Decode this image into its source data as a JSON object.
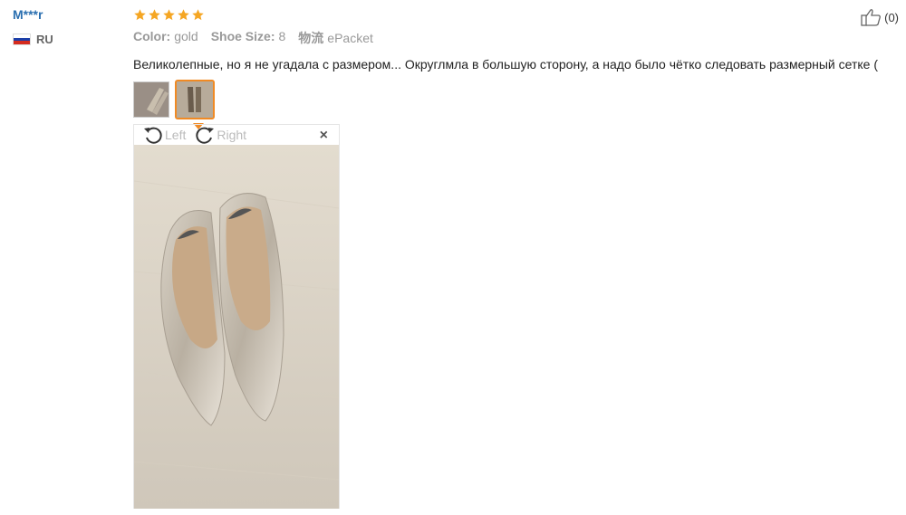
{
  "user": {
    "name": "M***r",
    "country_code": "RU",
    "flag_colors": [
      "#ffffff",
      "#1c3fa8",
      "#d52b1e"
    ]
  },
  "review": {
    "rating": 5,
    "star_color": "#f5a623",
    "meta": [
      {
        "label": "Color:",
        "value": "gold"
      },
      {
        "label": "Shoe Size:",
        "value": "8"
      },
      {
        "label": "物流",
        "value": "ePacket"
      }
    ],
    "text": "Великолепные, но я не угадала с размером... Округлмла в большую сторону, а надо было чётко следовать размерный сетке (",
    "thumbnails": [
      {
        "icon": "shoe-photo-thumbnail-1",
        "active": false
      },
      {
        "icon": "shoe-photo-thumbnail-2",
        "active": true
      }
    ],
    "viewer": {
      "rotate_left_label": "Left",
      "rotate_right_label": "Right",
      "close_glyph": "×"
    },
    "helpful_count": "(0)"
  },
  "accent_color": "#f08a24"
}
